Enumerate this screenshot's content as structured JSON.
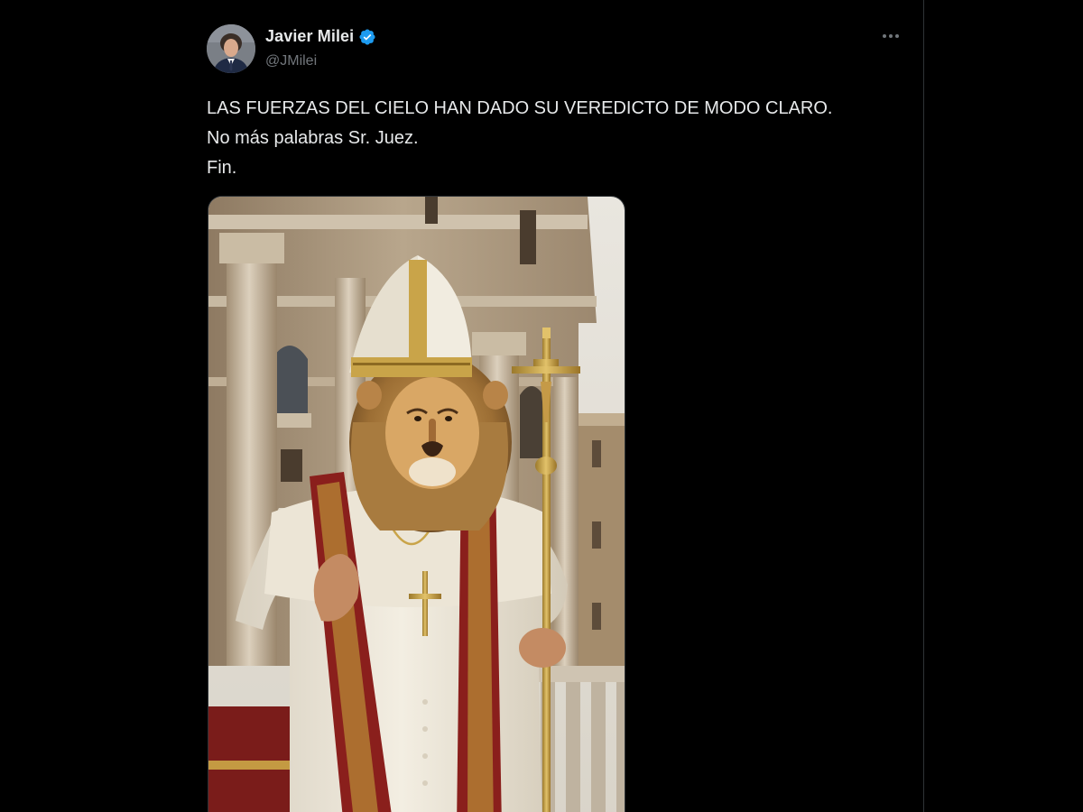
{
  "author": {
    "display_name": "Javier Milei",
    "handle": "@JMilei",
    "verified": true,
    "avatar_icon": "profile-photo",
    "verified_icon": "verified-badge-icon",
    "verified_color": "#1d9bf0"
  },
  "tweet": {
    "lines": [
      "LAS FUERZAS DEL CIELO HAN DADO SU VEREDICTO DE MODO CLARO.",
      "No más palabras Sr. Juez.",
      "Fin."
    ],
    "more_icon": "more-options-icon"
  },
  "media": {
    "type": "image",
    "image_icon": "lion-pope-illustration"
  },
  "colors": {
    "background": "#000000",
    "text_primary": "#e7e9ea",
    "text_secondary": "#71767b",
    "divider": "#2f3336"
  }
}
